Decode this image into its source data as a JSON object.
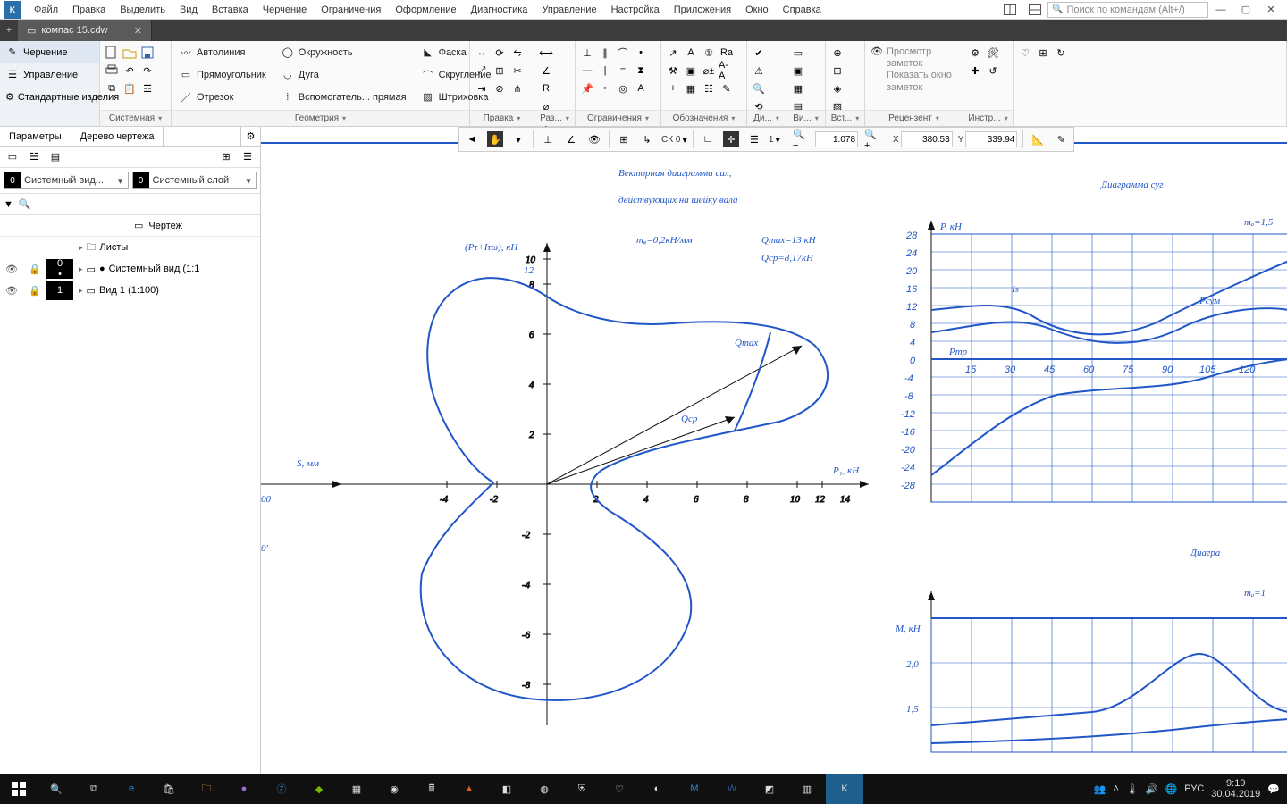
{
  "menubar": {
    "items": [
      "Файл",
      "Правка",
      "Выделить",
      "Вид",
      "Вставка",
      "Черчение",
      "Ограничения",
      "Оформление",
      "Диагностика",
      "Управление",
      "Настройка",
      "Приложения",
      "Окно",
      "Справка"
    ],
    "search_placeholder": "Поиск по командам (Alt+/)"
  },
  "tabbar": {
    "tab_label": "компас 15.cdw"
  },
  "ribbon": {
    "groups": {
      "g0_rows": [
        "Черчение",
        "Управление",
        "Стандартные изделия"
      ],
      "g1_label": "Системная",
      "g2_label": "Геометрия",
      "g2_items": [
        {
          "icon": "autoline",
          "label": "Автолиния"
        },
        {
          "icon": "rect",
          "label": "Прямоугольник"
        },
        {
          "icon": "segment",
          "label": "Отрезок"
        },
        {
          "icon": "circle",
          "label": "Окружность"
        },
        {
          "icon": "arc",
          "label": "Дуга"
        },
        {
          "icon": "helper",
          "label": "Вспомогатель... прямая"
        },
        {
          "icon": "chamfer",
          "label": "Фаска"
        },
        {
          "icon": "fillet",
          "label": "Скругление"
        },
        {
          "icon": "hatch",
          "label": "Штриховка"
        }
      ],
      "g3_label": "Правка",
      "g4_label": "Раз...",
      "g5_label": "Ограничения",
      "g6_label": "Обозначения",
      "g7_label": "Ди...",
      "g8_label": "Ви...",
      "g9_label": "Вст...",
      "review_title": "Просмотр заметок",
      "review_sub": "Показать окно заметок",
      "g10_label": "Рецензент",
      "g11_label": "Инстр..."
    }
  },
  "left": {
    "tab1": "Параметры",
    "tab2": "Дерево чертежа",
    "combo1": "Системный вид...",
    "combo1_num": "0",
    "combo2": "Системный слой",
    "combo2_num": "0",
    "filter_placeholder": "",
    "tree_root": "Чертеж",
    "tree_sheets": "Листы",
    "tree_view0": "Системный вид (1:1",
    "tree_view0_num": "0",
    "tree_view1": "Вид 1 (1:100)",
    "tree_view1_num": "1"
  },
  "canvastb": {
    "cs_label": "СК 0",
    "one_label": "1",
    "zoom": "1.078",
    "x_label": "X",
    "x": "380.53",
    "y_label": "Y",
    "y": "339.94"
  },
  "drawing": {
    "title1": "Векторная диаграмма сил,",
    "title2": "действующих на шейку вала",
    "axis_y": "(Pτ+Iτω), кН",
    "axis_x": "P₁, кН",
    "s_label": "S, мм",
    "mq": "mᵩ=0,2кН/мм",
    "qmax_info": "Qmax=13 кН",
    "qcp_info": "Qср=8,17кН",
    "qmax": "Qmax",
    "qcp": "Qср",
    "right_title": "Диаграмма суг",
    "right_axis": "P, кН",
    "right_m": "mₐ=1,5",
    "right_lbl_is": "Is",
    "right_lbl_psum": "Pсум",
    "right_lbl_pmp": "Pтр",
    "right2_title": "Диагра",
    "right2_axis": "M, кН",
    "right2_m": "mₐ=1"
  },
  "chart_data": [
    {
      "type": "line",
      "title": "Векторная диаграмма сил, действующих на шейку вала",
      "xlabel": "P₁, кН",
      "ylabel": "(Pτ+Iτω), кН",
      "xlim": [
        -6,
        14
      ],
      "ylim": [
        -10,
        12
      ],
      "annotations": [
        "Qmax=13 кН",
        "Qср=8,17кН",
        "mᵩ=0,2кН/мм"
      ],
      "series": [
        {
          "name": "vector-locus",
          "closed": true,
          "points": [
            [
              0,
              9.3
            ],
            [
              -1,
              10.2
            ],
            [
              -3,
              10.8
            ],
            [
              -4.5,
              10.2
            ],
            [
              -5.2,
              8.5
            ],
            [
              -5,
              6
            ],
            [
              -4,
              2
            ],
            [
              -3.4,
              0
            ],
            [
              -3,
              -0.8
            ],
            [
              -4.2,
              -2
            ],
            [
              -5.2,
              -4
            ],
            [
              -5,
              -6.8
            ],
            [
              -3.5,
              -8.3
            ],
            [
              -1,
              -9
            ],
            [
              1,
              -9.2
            ],
            [
              3,
              -8.8
            ],
            [
              5,
              -7.2
            ],
            [
              6,
              -5
            ],
            [
              5,
              -2.5
            ],
            [
              3,
              -1
            ],
            [
              2,
              0
            ],
            [
              4,
              1.5
            ],
            [
              7,
              2.3
            ],
            [
              9.5,
              3
            ],
            [
              11.8,
              4.5
            ],
            [
              12.5,
              6
            ],
            [
              11.5,
              7.4
            ],
            [
              9,
              8
            ],
            [
              5,
              8.2
            ],
            [
              2,
              8.5
            ],
            [
              0,
              9.3
            ]
          ]
        }
      ],
      "vectors": [
        {
          "name": "Qmax",
          "from": [
            0,
            0
          ],
          "to": [
            11.8,
            6.8
          ]
        },
        {
          "name": "Qср",
          "from": [
            0,
            0
          ],
          "to": [
            8,
            3
          ]
        }
      ]
    },
    {
      "type": "line",
      "title": "Диаграмма сум.",
      "xlabel": "",
      "ylabel": "P, кН",
      "xlim": [
        0,
        135
      ],
      "ylim": [
        -28,
        28
      ],
      "x_ticks": [
        15,
        30,
        45,
        60,
        75,
        90,
        105,
        120
      ],
      "y_ticks": [
        -28,
        -24,
        -20,
        -16,
        -12,
        -8,
        -4,
        0,
        4,
        8,
        12,
        16,
        20,
        24,
        28
      ],
      "series": [
        {
          "name": "Is",
          "values_hint": "oscillating upper curve"
        },
        {
          "name": "Pсум",
          "values_hint": "mid curve crossing near 60–90"
        },
        {
          "name": "Pтр",
          "values_hint": "near-zero line"
        }
      ]
    },
    {
      "type": "line",
      "title": "Диагра...",
      "xlabel": "",
      "ylabel": "M, кН",
      "ylim": [
        1.0,
        2.5
      ],
      "y_ticks": [
        1.5,
        2.0
      ]
    }
  ],
  "taskbar": {
    "lang": "РУС",
    "time": "9:19",
    "date": "30.04.2019"
  }
}
